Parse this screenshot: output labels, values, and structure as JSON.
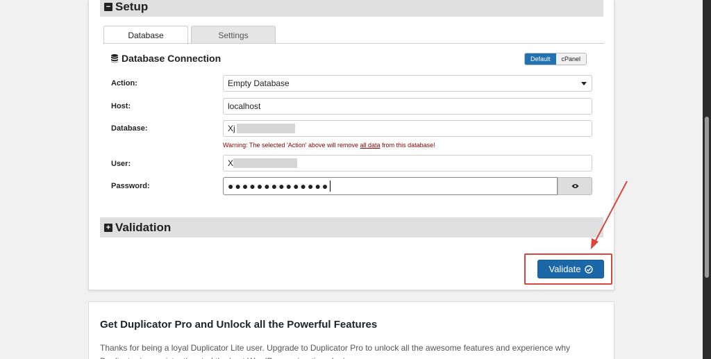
{
  "setup": {
    "header_title": "Setup",
    "tabs": [
      {
        "label": "Database",
        "active": true
      },
      {
        "label": "Settings",
        "active": false
      }
    ],
    "db_connection": {
      "title": "Database Connection",
      "mode_default": "Default",
      "mode_cpanel": "cPanel"
    },
    "form": {
      "action_label": "Action:",
      "action_value": "Empty Database",
      "host_label": "Host:",
      "host_value": "localhost",
      "database_label": "Database:",
      "database_value": "Xj",
      "warning_before": "Warning: The selected 'Action' above will remove ",
      "warning_link": "all data",
      "warning_after": " from this database!",
      "user_label": "User:",
      "user_value": "X",
      "password_label": "Password:",
      "password_mask": "●●●●●●●●●●●●●●"
    }
  },
  "validation": {
    "header_title": "Validation",
    "validate_label": "Validate"
  },
  "promo": {
    "title": "Get Duplicator Pro and Unlock all the Powerful Features",
    "text": "Thanks for being a loyal Duplicator Lite user. Upgrade to Duplicator Pro to unlock all the awesome features and experience why Duplicator is consistently rated the best WordPress migration plugin."
  },
  "colors": {
    "accent": "#2271b1",
    "validate_button": "#1c67a8",
    "highlight_red": "#d9453c",
    "warning_text": "#8b0000"
  }
}
